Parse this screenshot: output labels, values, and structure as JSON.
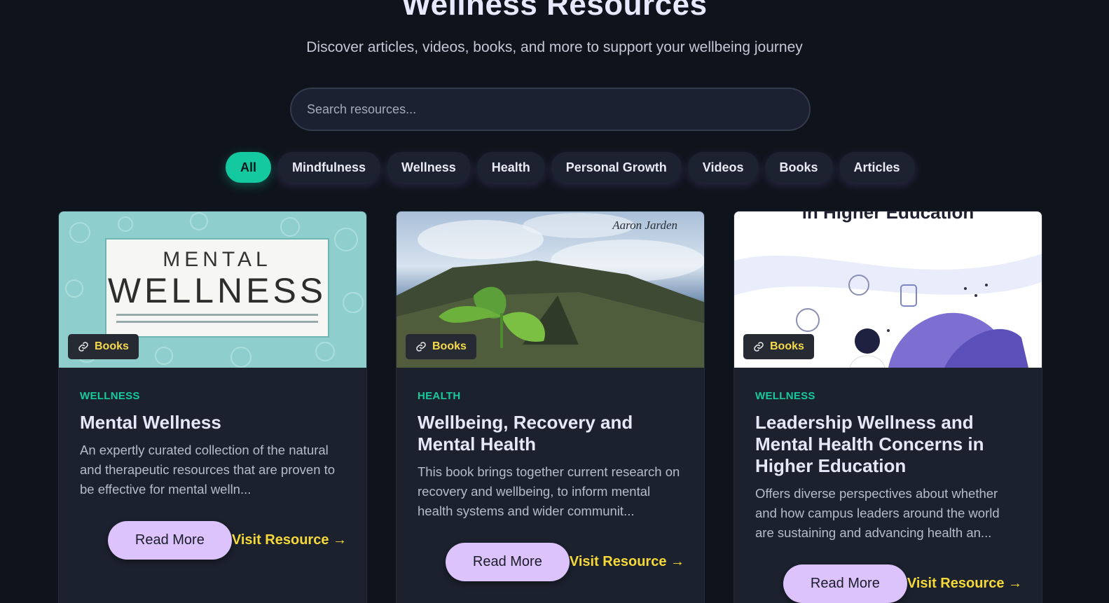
{
  "header": {
    "title": "Wellness Resources",
    "subtitle": "Discover articles, videos, books, and more to support your wellbeing journey"
  },
  "search": {
    "placeholder": "Search resources...",
    "value": ""
  },
  "filters": [
    "All",
    "Mindfulness",
    "Wellness",
    "Health",
    "Personal Growth",
    "Videos",
    "Books",
    "Articles"
  ],
  "active_filter": "All",
  "colors": {
    "accent": "#14c8a0",
    "button": "#dcc3fb",
    "link": "#f6d838",
    "background": "#0f141c"
  },
  "cards": [
    {
      "badge": "Books",
      "image_text": {
        "line1": "MENTAL",
        "line2": "WELLNESS"
      },
      "category": "WELLNESS",
      "title": "Mental Wellness",
      "description": "An expertly curated collection of the natural and therapeutic resources that are proven to be effective for mental welln...",
      "read_more": "Read More",
      "visit": "Visit Resource →"
    },
    {
      "badge": "Books",
      "image_text": {
        "line1": "Aaron Jarden"
      },
      "category": "HEALTH",
      "title": "Wellbeing, Recovery and Mental Health",
      "description": "This book brings together current research on recovery and wellbeing, to inform mental health systems and wider communit...",
      "read_more": "Read More",
      "visit": "Visit Resource →"
    },
    {
      "badge": "Books",
      "image_text": {
        "line1": "in Higher Education"
      },
      "category": "WELLNESS",
      "title": "Leadership Wellness and Mental Health Concerns in Higher Education",
      "description": "Offers diverse perspectives about whether and how campus leaders around the world are sustaining and advancing health an...",
      "read_more": "Read More",
      "visit": "Visit Resource →"
    }
  ]
}
